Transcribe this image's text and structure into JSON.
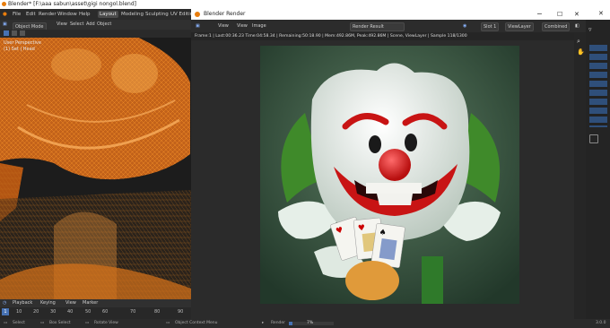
{
  "app": {
    "title": "Blender* [F:\\aaa sabun\\asset\\gigi nongol.blend]",
    "menu": [
      "File",
      "Edit",
      "Render",
      "Window",
      "Help"
    ],
    "workspaces": [
      "Layout",
      "Modeling",
      "Sculpting",
      "UV Editing"
    ],
    "active_workspace": "Layout"
  },
  "left_view": {
    "mode": "Object Mode",
    "menu": [
      "View",
      "Select",
      "Add",
      "Object"
    ],
    "label_line1": "User Perspective",
    "label_line2": "(1) Set | Head"
  },
  "timeline": {
    "menu": [
      "Playback",
      "Keying",
      "View",
      "Marker"
    ],
    "current_frame": "1",
    "ticks": [
      "10",
      "20",
      "30",
      "40",
      "50",
      "60",
      "70",
      "80",
      "90"
    ]
  },
  "status": {
    "select": "Select",
    "box_select": "Box Select",
    "rotate": "Rotate View",
    "context_menu": "Object Context Menu",
    "render_label": "Render",
    "render_percent": "7%",
    "version": "3.0.0"
  },
  "render_window": {
    "title": "Blender Render",
    "menu": [
      "View",
      "View",
      "Image"
    ],
    "image_name": "Render Result",
    "slot": "Slot 1",
    "view_layer": "ViewLayer",
    "pass": "Combined",
    "stats": "Frame:1 | Last:00:36.23 Time:04:58.34 | Remaining:50:18.90 | Mem:492.86M, Peak:492.86M | Scene, ViewLayer | Sample 118/1300"
  },
  "colors": {
    "accent": "#4772b3",
    "wire_orange": "#e87d0d",
    "render_bg": "#3d5a44"
  }
}
